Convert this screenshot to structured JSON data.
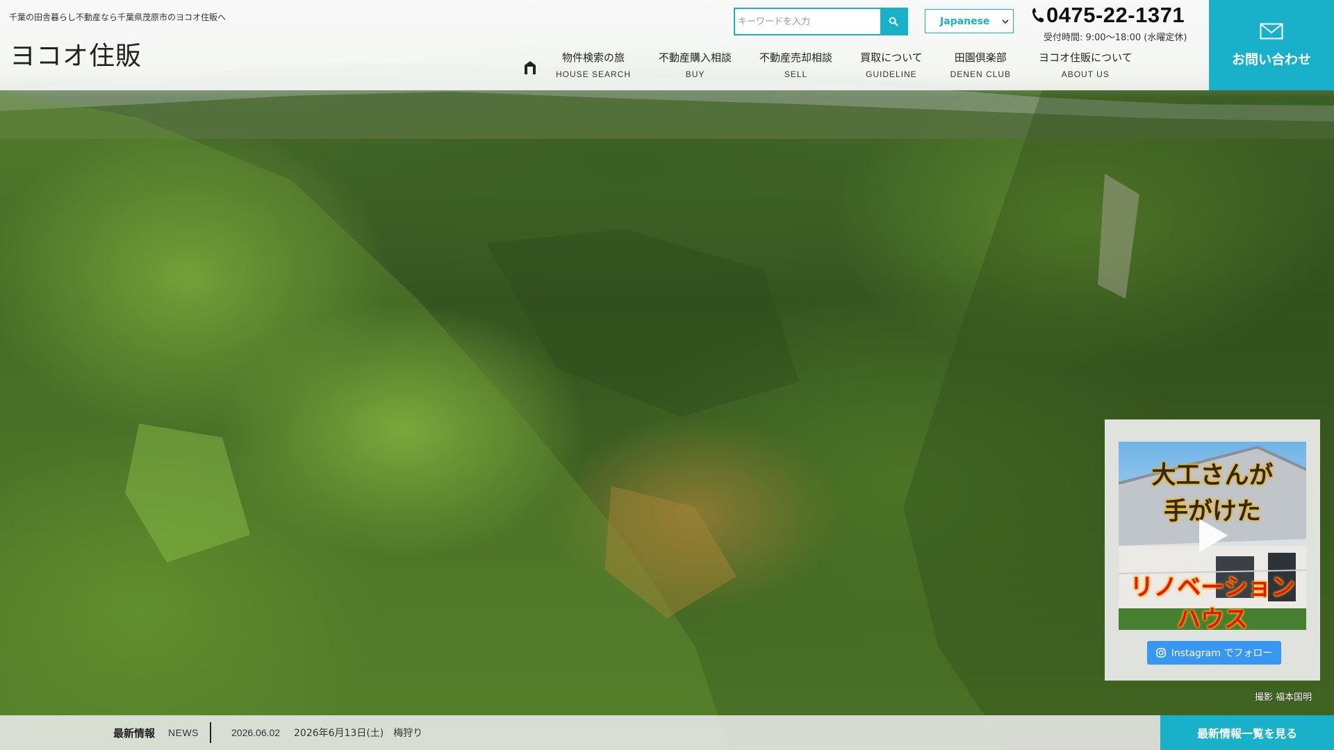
{
  "header": {
    "tagline": "千葉の田舎暮らし不動産なら千葉県茂原市のヨコオ住販へ",
    "logo": "ヨコオ住販",
    "search_placeholder": "キーワードを入力",
    "language": "Japanese",
    "phone": "0475-22-1371",
    "hours": "受付時間: 9:00〜18:00 (水曜定休)",
    "contact_label": "お問い合わせ"
  },
  "nav": {
    "items": [
      {
        "jp": "物件検索の旅",
        "en": "HOUSE SEARCH"
      },
      {
        "jp": "不動産購入相談",
        "en": "BUY"
      },
      {
        "jp": "不動産売却相談",
        "en": "SELL"
      },
      {
        "jp": "買取について",
        "en": "GUIDELINE"
      },
      {
        "jp": "田園倶楽部",
        "en": "DENEN CLUB"
      },
      {
        "jp": "ヨコオ住販について",
        "en": "ABOUT US"
      }
    ]
  },
  "instagram": {
    "thumb_line1": "大工さんが",
    "thumb_line2": "手がけた",
    "thumb_line3": "リノベーション",
    "thumb_line4": "ハウス",
    "follow_label": "Instagram でフォロー"
  },
  "credit": "撮影 福本国明",
  "news": {
    "title": "最新情報",
    "title_en": "NEWS",
    "date": "2026.06.02",
    "text": "2026年6月13日(土)　梅狩り",
    "view_all": "最新情報一覧を見る"
  },
  "colors": {
    "accent": "#19b1c9",
    "instagram_blue": "#3897f0"
  }
}
